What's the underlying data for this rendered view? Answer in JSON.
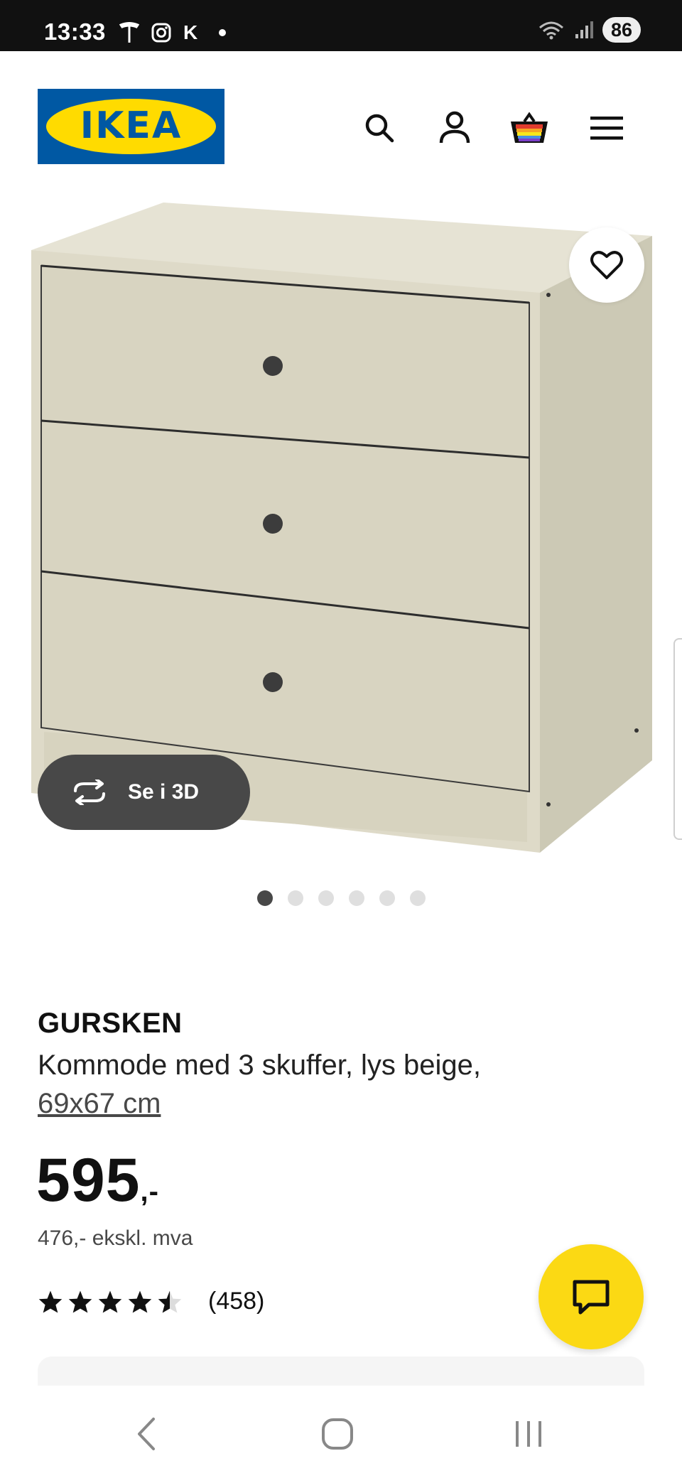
{
  "status_bar": {
    "time": "13:33",
    "carrier_letter": "K",
    "battery": "86"
  },
  "header": {
    "logo_text": "IKEA",
    "icons": [
      "search-icon",
      "account-icon",
      "cart-icon",
      "menu-icon"
    ]
  },
  "hero": {
    "button_3d_label": "Se i 3D",
    "carousel_count": 6,
    "carousel_active_index": 0
  },
  "product": {
    "name": "GURSKEN",
    "description": "Kommode med 3 skuffer, lys beige,",
    "size_link": "69x67 cm",
    "price_main": "595",
    "price_suffix": ",-",
    "price_ex_vat": "476,- ekskl. mva",
    "rating_value": 4.5,
    "rating_max": 5,
    "rating_count": "(458)"
  },
  "colors": {
    "ikea_blue": "#0058a3",
    "ikea_yellow": "#ffdb00",
    "chat_yellow": "#fbd914",
    "dark_pill": "#484848",
    "dresser": "#dcd8c4"
  }
}
